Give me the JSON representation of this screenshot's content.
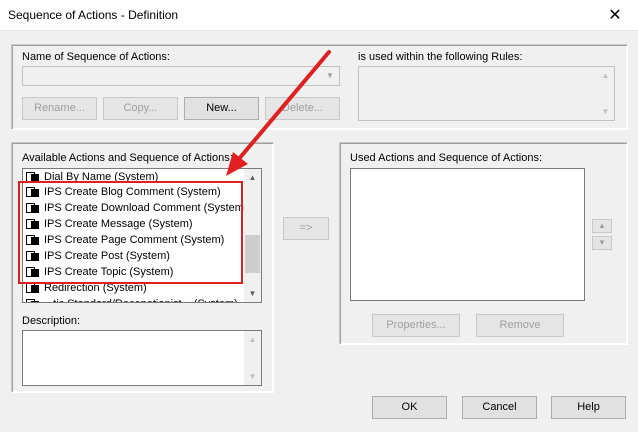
{
  "window": {
    "title": "Sequence of Actions - Definition",
    "close_glyph": "✕"
  },
  "top": {
    "name_label": "Name of Sequence of Actions:",
    "used_label": "is used within the following Rules:",
    "rename": "Rename...",
    "copy": "Copy...",
    "new": "New...",
    "delete": "Delete..."
  },
  "available": {
    "label": "Available Actions and Sequence of Actions:",
    "items": [
      "Dial By Name (System)",
      "IPS Create Blog Comment (System)",
      "IPS Create Download Comment (System)",
      "IPS Create Message (System)",
      "IPS Create Page Comment (System)",
      "IPS Create Post (System)",
      "IPS Create Topic (System)",
      "Redirection (System)",
      "...tic Standard/Recepetionist... (System)"
    ]
  },
  "transfer": {
    "label": "=>"
  },
  "used": {
    "label": "Used Actions and Sequence of Actions:",
    "properties": "Properties...",
    "remove": "Remove"
  },
  "description": {
    "label": "Description:"
  },
  "footer": {
    "ok": "OK",
    "cancel": "Cancel",
    "help": "Help"
  },
  "colors": {
    "annotation_red": "#e02020",
    "focus_blue": "#0078d7"
  }
}
